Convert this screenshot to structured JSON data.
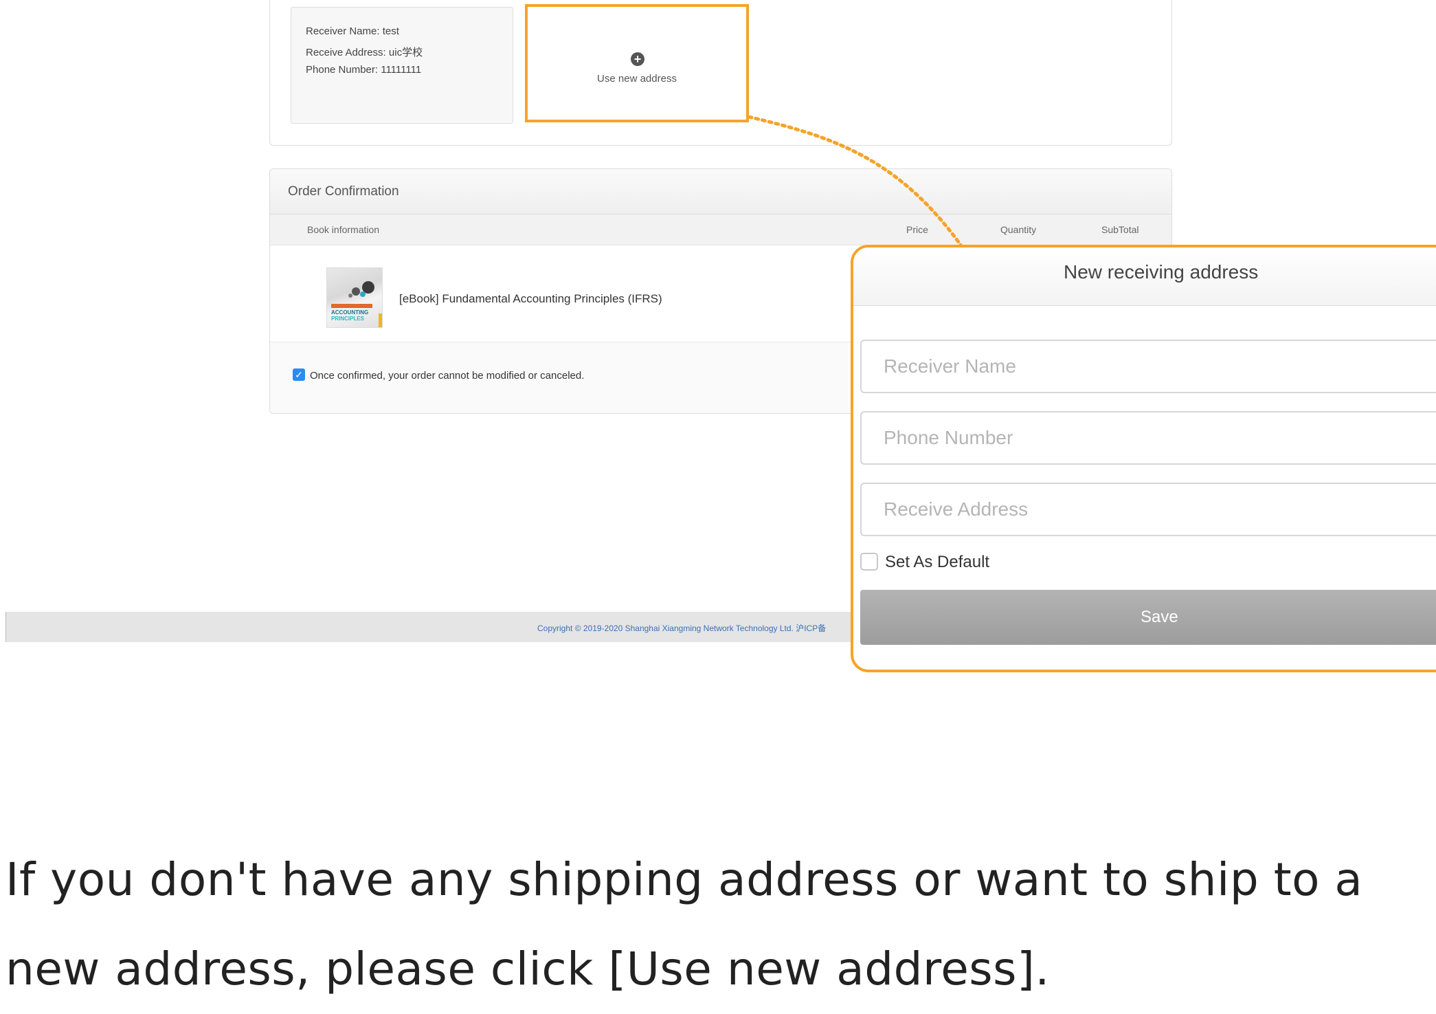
{
  "address_section": {
    "saved_address": {
      "receiver_name": "Receiver Name: test",
      "receive_address": "Receive Address: uic学校",
      "phone_number": "Phone Number: 11111111"
    },
    "new_address_label": "Use new address",
    "new_address_icon": "plus-circle-icon"
  },
  "order": {
    "title": "Order Confirmation",
    "columns": {
      "book_information": "Book information",
      "price": "Price",
      "quantity": "Quantity",
      "subtotal": "SubTotal"
    },
    "item": {
      "title": "[eBook] Fundamental Accounting Principles (IFRS)",
      "cover_text_line1": "ACCOUNTING",
      "cover_text_line2": "PRINCIPLES"
    },
    "confirm_text": "Once confirmed, your order cannot be modified or canceled.",
    "confirm_checked": true
  },
  "footer": {
    "copyright": "Copyright © 2019-2020 Shanghai Xiangming Network Technology Ltd. 沪ICP备"
  },
  "modal": {
    "title": "New receiving address",
    "receiver_name_placeholder": "Receiver Name",
    "phone_number_placeholder": "Phone Number",
    "receive_address_placeholder": "Receive Address",
    "set_default_label": "Set As Default",
    "set_default_checked": false,
    "save_label": "Save"
  },
  "caption": "If you don't have any shipping address or want to ship to a new address, please click [Use new address].",
  "colors": {
    "highlight": "#f6a32a",
    "checkbox": "#2a8cf0",
    "footer_link": "#3b6fb6",
    "save_button": "#a8a8a8"
  }
}
